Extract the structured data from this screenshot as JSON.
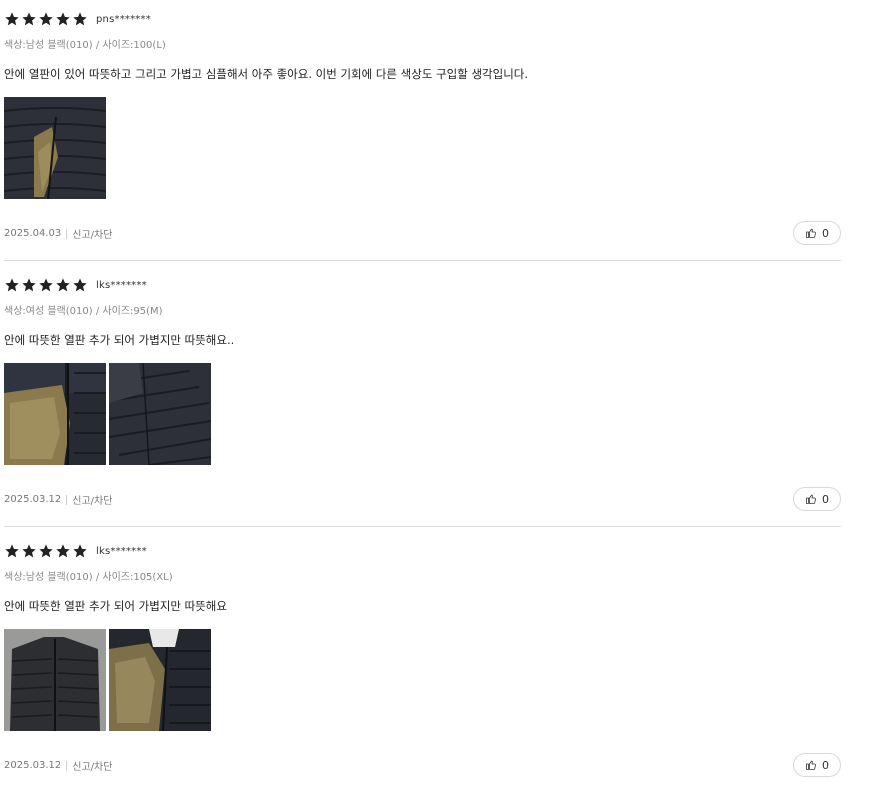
{
  "reviews": [
    {
      "rating": 5,
      "user": "pns*******",
      "option": "색상:남성 블랙(010) / 사이즈:100(L)",
      "text": "안에 열판이 있어 따뜻하고 그리고 가볍고 심플해서 아주 좋아요. 이번 기회에 다른 색상도 구입할 생각입니다.",
      "date": "2025.04.03",
      "report_label": "신고/차단",
      "like_count": "0"
    },
    {
      "rating": 5,
      "user": "lks*******",
      "option": "색상:여성 블랙(010) / 사이즈:95(M)",
      "text": "안에 따뜻한 열판 추가 되어 가볍지만 따뜻해요..",
      "date": "2025.03.12",
      "report_label": "신고/차단",
      "like_count": "0"
    },
    {
      "rating": 5,
      "user": "lks*******",
      "option": "색상:남성 블랙(010) / 사이즈:105(XL)",
      "text": "안에 따뜻한 열판 추가 되어 가볍지만 따뜻해요",
      "date": "2025.03.12",
      "report_label": "신고/차단",
      "like_count": "0"
    }
  ],
  "icons": {
    "star": "star-icon",
    "like": "thumbs-up-icon"
  },
  "colors": {
    "star": "#222222",
    "divider": "#dcdcdc",
    "jacket": "#2b2f36",
    "lining": "#8a7a4e"
  }
}
